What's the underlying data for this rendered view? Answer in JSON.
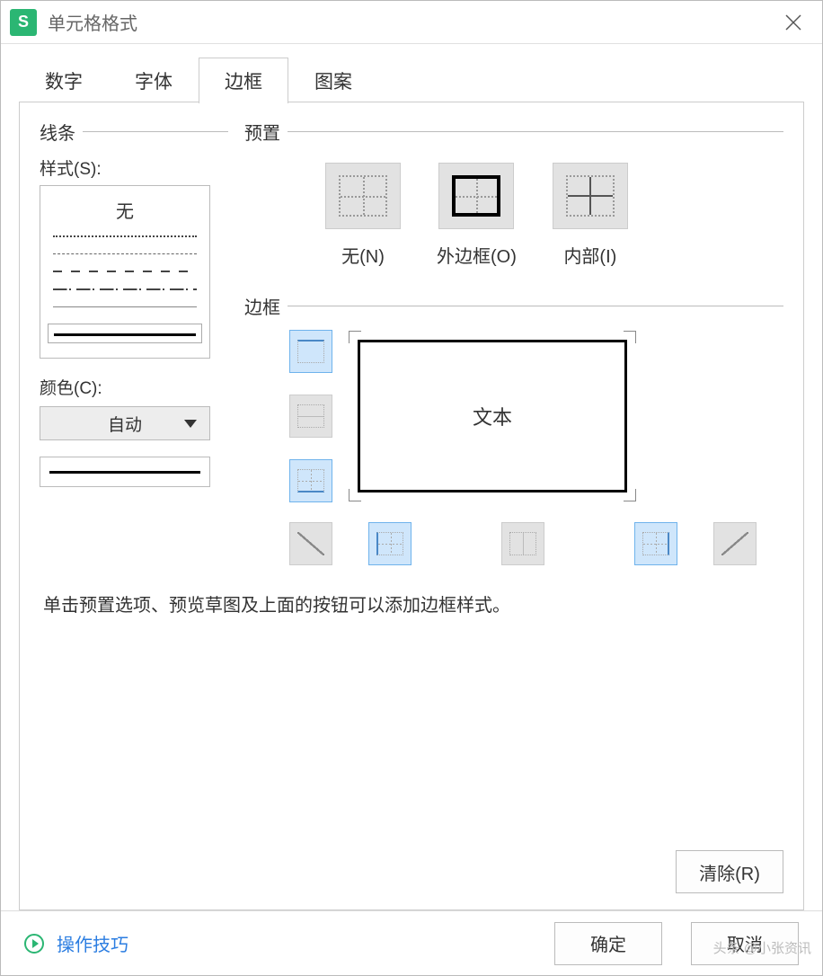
{
  "window": {
    "app_icon": "S",
    "title": "单元格格式"
  },
  "tabs": {
    "number": "数字",
    "font": "字体",
    "border": "边框",
    "pattern": "图案"
  },
  "left": {
    "group": "线条",
    "style_label": "样式(S):",
    "none": "无",
    "color_label": "颜色(C):",
    "color_value": "自动"
  },
  "presets": {
    "group": "预置",
    "none": "无(N)",
    "outer": "外边框(O)",
    "inner": "内部(I)"
  },
  "border_group": "边框",
  "preview_text": "文本",
  "hint": "单击预置选项、预览草图及上面的按钮可以添加边框样式。",
  "buttons": {
    "clear": "清除(R)",
    "ok": "确定",
    "cancel": "取消",
    "tips": "操作技巧"
  },
  "watermark": "头条 @小张资讯"
}
